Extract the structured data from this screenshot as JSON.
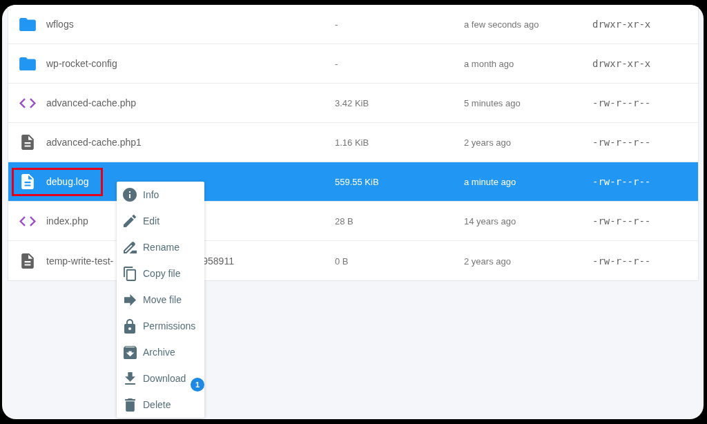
{
  "file_table": {
    "rows": [
      {
        "kind": "folder",
        "name": "wflogs",
        "size": "-",
        "modified": "a few seconds ago",
        "permissions": "drwxr-xr-x",
        "selected": false,
        "outlined": false
      },
      {
        "kind": "folder",
        "name": "wp-rocket-config",
        "size": "-",
        "modified": "a month ago",
        "permissions": "drwxr-xr-x",
        "selected": false,
        "outlined": false
      },
      {
        "kind": "code",
        "name": "advanced-cache.php",
        "size": "3.42 KiB",
        "modified": "5 minutes ago",
        "permissions": "-rw-r--r--",
        "selected": false,
        "outlined": false
      },
      {
        "kind": "document",
        "name": "advanced-cache.php1",
        "size": "1.16 KiB",
        "modified": "2 years ago",
        "permissions": "-rw-r--r--",
        "selected": false,
        "outlined": false
      },
      {
        "kind": "document",
        "name": "debug.log",
        "size": "559.55 KiB",
        "modified": "a minute ago",
        "permissions": "-rw-r--r--",
        "selected": true,
        "outlined": true
      },
      {
        "kind": "code",
        "name": "index.php",
        "size": "28 B",
        "modified": "14 years ago",
        "permissions": "-rw-r--r--",
        "selected": false,
        "outlined": false
      },
      {
        "kind": "document",
        "name_parts": [
          "temp-write-test-",
          "958911"
        ],
        "size": "0 B",
        "modified": "2 years ago",
        "permissions": "-rw-r--r--",
        "selected": false,
        "outlined": false
      }
    ]
  },
  "context_menu": {
    "items": [
      {
        "kind": "info",
        "label": "Info"
      },
      {
        "kind": "edit",
        "label": "Edit"
      },
      {
        "kind": "rename",
        "label": "Rename"
      },
      {
        "kind": "copy",
        "label": "Copy file"
      },
      {
        "kind": "move",
        "label": "Move file"
      },
      {
        "kind": "permissions",
        "label": "Permissions"
      },
      {
        "kind": "archive",
        "label": "Archive"
      },
      {
        "kind": "download",
        "label": "Download",
        "badge": "1"
      },
      {
        "kind": "delete",
        "label": "Delete"
      }
    ]
  }
}
